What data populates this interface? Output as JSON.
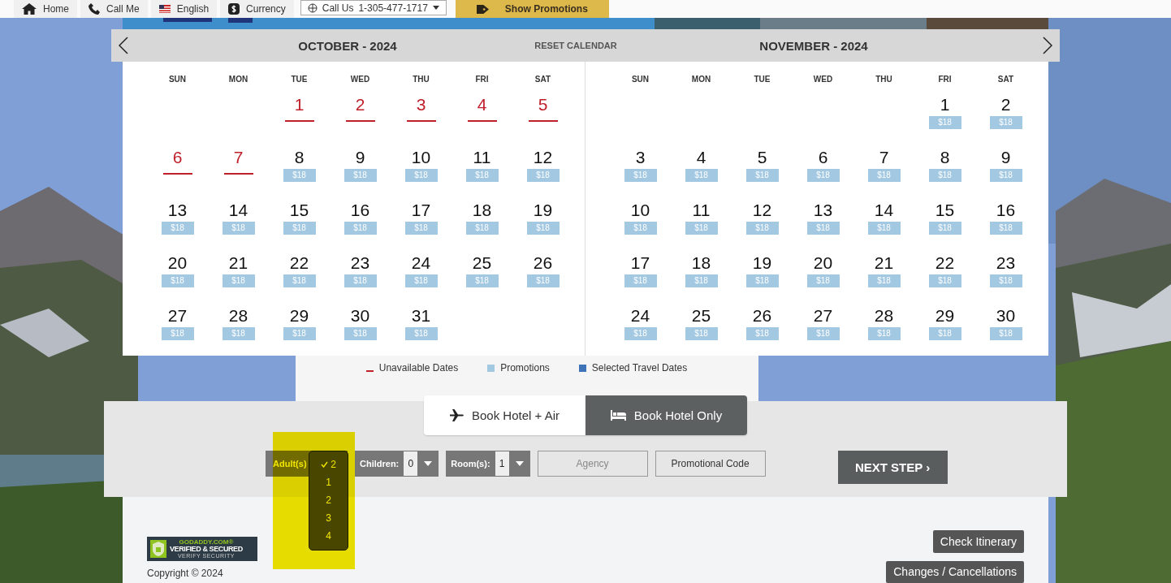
{
  "top_bar": {
    "items": [
      {
        "kind": "home",
        "label": "Home"
      },
      {
        "kind": "phone",
        "label": "Call Me"
      },
      {
        "kind": "flag",
        "label": "English"
      },
      {
        "kind": "currency",
        "label": "Currency"
      },
      {
        "kind": "select",
        "label": "Call Us",
        "value": "1-305-477-1717"
      },
      {
        "kind": "promo",
        "label": "Show Promotions"
      }
    ]
  },
  "calendar": {
    "reset": "RESET CALENDAR",
    "months": [
      {
        "title": "OCTOBER - 2024",
        "weekdays": [
          "SUN",
          "MON",
          "TUE",
          "WED",
          "THU",
          "FRI",
          "SAT"
        ],
        "days": [
          {
            "kind": "blank"
          },
          {
            "kind": "blank"
          },
          {
            "kind": "unavailable",
            "day": "1"
          },
          {
            "kind": "unavailable",
            "day": "2"
          },
          {
            "kind": "unavailable",
            "day": "3"
          },
          {
            "kind": "unavailable",
            "day": "4"
          },
          {
            "kind": "unavailable",
            "day": "5"
          },
          {
            "kind": "unavailable",
            "day": "6"
          },
          {
            "kind": "unavailable",
            "day": "7"
          },
          {
            "kind": "promo",
            "day": "8",
            "price": "$18"
          },
          {
            "kind": "promo",
            "day": "9",
            "price": "$18"
          },
          {
            "kind": "promo",
            "day": "10",
            "price": "$18"
          },
          {
            "kind": "promo",
            "day": "11",
            "price": "$18"
          },
          {
            "kind": "promo",
            "day": "12",
            "price": "$18"
          },
          {
            "kind": "promo",
            "day": "13",
            "price": "$18"
          },
          {
            "kind": "promo",
            "day": "14",
            "price": "$18"
          },
          {
            "kind": "promo",
            "day": "15",
            "price": "$18"
          },
          {
            "kind": "promo",
            "day": "16",
            "price": "$18"
          },
          {
            "kind": "promo",
            "day": "17",
            "price": "$18"
          },
          {
            "kind": "promo",
            "day": "18",
            "price": "$18"
          },
          {
            "kind": "promo",
            "day": "19",
            "price": "$18"
          },
          {
            "kind": "promo",
            "day": "20",
            "price": "$18"
          },
          {
            "kind": "promo",
            "day": "21",
            "price": "$18"
          },
          {
            "kind": "promo",
            "day": "22",
            "price": "$18"
          },
          {
            "kind": "promo",
            "day": "23",
            "price": "$18"
          },
          {
            "kind": "promo",
            "day": "24",
            "price": "$18"
          },
          {
            "kind": "promo",
            "day": "25",
            "price": "$18"
          },
          {
            "kind": "promo",
            "day": "26",
            "price": "$18"
          },
          {
            "kind": "promo",
            "day": "27",
            "price": "$18"
          },
          {
            "kind": "promo",
            "day": "28",
            "price": "$18"
          },
          {
            "kind": "promo",
            "day": "29",
            "price": "$18"
          },
          {
            "kind": "promo",
            "day": "30",
            "price": "$18"
          },
          {
            "kind": "promo",
            "day": "31",
            "price": "$18"
          }
        ]
      },
      {
        "title": "NOVEMBER - 2024",
        "weekdays": [
          "SUN",
          "MON",
          "TUE",
          "WED",
          "THU",
          "FRI",
          "SAT"
        ],
        "days": [
          {
            "kind": "blank"
          },
          {
            "kind": "blank"
          },
          {
            "kind": "blank"
          },
          {
            "kind": "blank"
          },
          {
            "kind": "blank"
          },
          {
            "kind": "promo",
            "day": "1",
            "price": "$18"
          },
          {
            "kind": "promo",
            "day": "2",
            "price": "$18"
          },
          {
            "kind": "promo",
            "day": "3",
            "price": "$18"
          },
          {
            "kind": "promo",
            "day": "4",
            "price": "$18"
          },
          {
            "kind": "promo",
            "day": "5",
            "price": "$18"
          },
          {
            "kind": "promo",
            "day": "6",
            "price": "$18"
          },
          {
            "kind": "promo",
            "day": "7",
            "price": "$18"
          },
          {
            "kind": "promo",
            "day": "8",
            "price": "$18"
          },
          {
            "kind": "promo",
            "day": "9",
            "price": "$18"
          },
          {
            "kind": "promo",
            "day": "10",
            "price": "$18"
          },
          {
            "kind": "promo",
            "day": "11",
            "price": "$18"
          },
          {
            "kind": "promo",
            "day": "12",
            "price": "$18"
          },
          {
            "kind": "promo",
            "day": "13",
            "price": "$18"
          },
          {
            "kind": "promo",
            "day": "14",
            "price": "$18"
          },
          {
            "kind": "promo",
            "day": "15",
            "price": "$18"
          },
          {
            "kind": "promo",
            "day": "16",
            "price": "$18"
          },
          {
            "kind": "promo",
            "day": "17",
            "price": "$18"
          },
          {
            "kind": "promo",
            "day": "18",
            "price": "$18"
          },
          {
            "kind": "promo",
            "day": "19",
            "price": "$18"
          },
          {
            "kind": "promo",
            "day": "20",
            "price": "$18"
          },
          {
            "kind": "promo",
            "day": "21",
            "price": "$18"
          },
          {
            "kind": "promo",
            "day": "22",
            "price": "$18"
          },
          {
            "kind": "promo",
            "day": "23",
            "price": "$18"
          },
          {
            "kind": "promo",
            "day": "24",
            "price": "$18"
          },
          {
            "kind": "promo",
            "day": "25",
            "price": "$18"
          },
          {
            "kind": "promo",
            "day": "26",
            "price": "$18"
          },
          {
            "kind": "promo",
            "day": "27",
            "price": "$18"
          },
          {
            "kind": "promo",
            "day": "28",
            "price": "$18"
          },
          {
            "kind": "promo",
            "day": "29",
            "price": "$18"
          },
          {
            "kind": "promo",
            "day": "30",
            "price": "$18"
          }
        ]
      }
    ],
    "legend": [
      {
        "kind": "line",
        "label": "Unavailable Dates",
        "color": "#c0202a"
      },
      {
        "kind": "swatch",
        "label": "Promotions",
        "color": "#a3c8e2"
      },
      {
        "kind": "swatch",
        "label": "Selected Travel Dates",
        "color": "#3f73b8"
      }
    ]
  },
  "booking": {
    "tabs": [
      {
        "kind": "plane",
        "label": "Book Hotel + Air",
        "selected": false
      },
      {
        "kind": "bed",
        "label": "Book Hotel Only",
        "selected": true
      }
    ],
    "adults": {
      "label": "Adult(s)",
      "options": [
        {
          "label": "2",
          "checked": true
        },
        {
          "label": "1",
          "checked": false
        },
        {
          "label": "2",
          "checked": false
        },
        {
          "label": "3",
          "checked": false
        },
        {
          "label": "4",
          "checked": false
        }
      ]
    },
    "children": {
      "label": "Children:",
      "value": "0"
    },
    "rooms": {
      "label": "Room(s):",
      "value": "1"
    },
    "agency": {
      "placeholder": "Agency"
    },
    "promo_code": "Promotional Code",
    "next": "NEXT STEP ›"
  },
  "footer": {
    "badge": {
      "brand": "GODADDY.COM®",
      "title": "VERIFIED & SECURED",
      "subtitle": "VERIFY SECURITY"
    },
    "copyright": "Copyright © 2024",
    "buttons": [
      "Check Itinerary",
      "Changes / Cancellations"
    ]
  }
}
